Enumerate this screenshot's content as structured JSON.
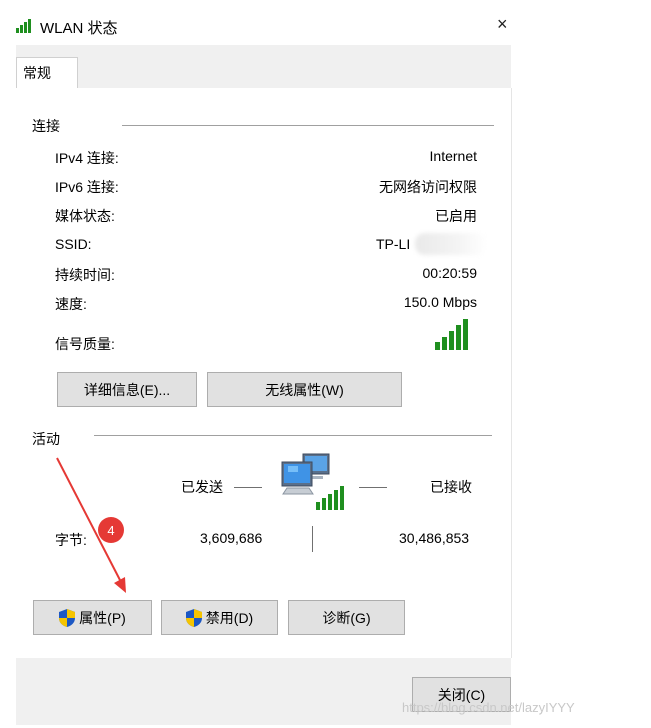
{
  "window": {
    "title": "WLAN 状态",
    "close_glyph": "×"
  },
  "tabs": [
    {
      "label": "常规"
    }
  ],
  "connection": {
    "group_title": "连接",
    "rows": [
      {
        "label": "IPv4 连接:",
        "value": "Internet"
      },
      {
        "label": "IPv6 连接:",
        "value": "无网络访问权限"
      },
      {
        "label": "媒体状态:",
        "value": "已启用"
      },
      {
        "label": "SSID:",
        "value": "TP-LI"
      },
      {
        "label": "持续时间:",
        "value": "00:20:59"
      },
      {
        "label": "速度:",
        "value": "150.0 Mbps"
      },
      {
        "label": "信号质量:",
        "value": ""
      }
    ],
    "details_button": "详细信息(E)...",
    "wireless_props_button": "无线属性(W)"
  },
  "activity": {
    "group_title": "活动",
    "sent_label": "已发送",
    "received_label": "已接收",
    "bytes_label": "字节:",
    "bytes_sent": "3,609,686",
    "bytes_received": "30,486,853"
  },
  "actions": {
    "properties_button": "属性(P)",
    "disable_button": "禁用(D)",
    "diagnose_button": "诊断(G)",
    "close_button": "关闭(C)"
  },
  "annotation": {
    "step_number": "4",
    "color": "#e53935"
  },
  "watermark": "https://blog.csdn.net/lazyIYYY",
  "colors": {
    "signal_green": "#1f8f1f",
    "button_bg": "#e1e1e1",
    "shield_blue": "#1c58c4",
    "shield_yellow": "#f5c400"
  }
}
